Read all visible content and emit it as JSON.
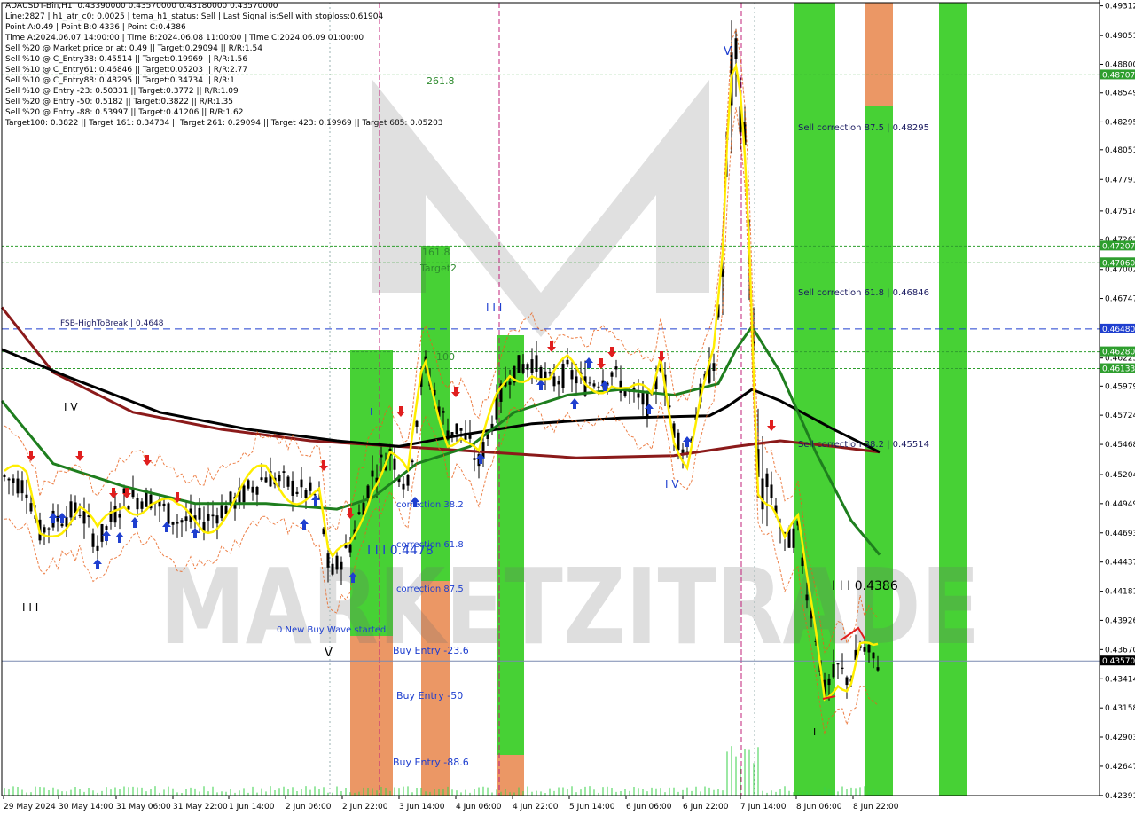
{
  "header": {
    "lines": [
      "ADAUSDT-Bin,H1  0.43390000 0.43570000 0.43180000 0.43570000",
      "Line:2827 | h1_atr_c0: 0.0025 | tema_h1_status: Sell | Last Signal is:Sell with stoploss:0.61904",
      "Point A:0.49 | Point B:0.4336 | Point C:0.4386",
      "Time A:2024.06.07 14:00:00 | Time B:2024.06.08 11:00:00 | Time C:2024.06.09 01:00:00",
      "Sell %20 @ Market price or at: 0.49 || Target:0.29094 || R/R:1.54",
      "Sell %10 @ C_Entry38: 0.45514 || Target:0.19969 || R/R:1.56",
      "Sell %10 @ C_Entry61: 0.46846 || Target:0.05203 || R/R:2.77",
      "Sell %10 @ C_Entry88: 0.48295 || Target:0.34734 || R/R:1",
      "Sell %10 @ Entry -23: 0.50331 || Target:0.3772 || R/R:1.09",
      "Sell %20 @ Entry -50: 0.5182 || Target:0.3822 || R/R:1.35",
      "Sell %20 @ Entry -88: 0.53997 || Target:0.41206 || R/R:1.62",
      "Target100: 0.3822 || Target 161: 0.34734 || Target 261: 0.29094 || Target 423: 0.19969 || Target 685: 0.05203"
    ]
  },
  "chart_data": {
    "type": "candlestick",
    "symbol": "ADAUSDT-Bin,H1",
    "ylim": [
      0.4239,
      0.4934
    ],
    "y_ticks": [
      "0.49312",
      "0.49051",
      "0.48800",
      "0.48549",
      "0.48295",
      "0.48051",
      "0.47791",
      "0.47514",
      "0.47263",
      "0.47002",
      "0.46747",
      "0.46480",
      "0.46225",
      "0.45979",
      "0.45724",
      "0.45468",
      "0.45204",
      "0.44949",
      "0.44693",
      "0.44437",
      "0.44181",
      "0.43926",
      "0.43670",
      "0.43414",
      "0.43158",
      "0.42903",
      "0.42647",
      "0.42391"
    ],
    "x_ticks": [
      "29 May 2024",
      "30 May 14:00",
      "31 May 06:00",
      "31 May 22:00",
      "1 Jun 14:00",
      "2 Jun 06:00",
      "2 Jun 22:00",
      "3 Jun 14:00",
      "4 Jun 06:00",
      "4 Jun 22:00",
      "5 Jun 14:00",
      "6 Jun 06:00",
      "6 Jun 22:00",
      "7 Jun 14:00",
      "8 Jun 06:00",
      "8 Jun 22:00"
    ],
    "price_tags": [
      {
        "value": "0.48707",
        "color": "#2e9e2e"
      },
      {
        "value": "0.47207",
        "color": "#2e9e2e"
      },
      {
        "value": "0.47060",
        "color": "#2e9e2e"
      },
      {
        "value": "0.46480",
        "color": "#1f3fcf"
      },
      {
        "value": "0.46280",
        "color": "#2e9e2e"
      },
      {
        "value": "0.46133",
        "color": "#2e9e2e"
      },
      {
        "value": "0.43570",
        "color": "#000000"
      }
    ],
    "levels": [
      {
        "value": 0.48707,
        "color": "#2e9e2e",
        "style": "dotted"
      },
      {
        "value": 0.47207,
        "color": "#2e9e2e",
        "style": "dotted"
      },
      {
        "value": 0.4706,
        "color": "#2e9e2e",
        "style": "dotted"
      },
      {
        "value": 0.4648,
        "color": "#1f3fcf",
        "style": "dashed"
      },
      {
        "value": 0.4628,
        "color": "#2e9e2e",
        "style": "dotted"
      },
      {
        "value": 0.46133,
        "color": "#2e9e2e",
        "style": "dotted"
      },
      {
        "value": 0.4357,
        "color": "#7a8ab0",
        "style": "solid"
      }
    ],
    "annotations": [
      {
        "text": "FSB-HighToBreak | 0.4648",
        "color": "#1a1a60"
      },
      {
        "text": "261.8",
        "color": "#2e8b2e"
      },
      {
        "text": "161.8",
        "color": "#2e8b2e"
      },
      {
        "text": "Target2",
        "color": "#2e8b2e"
      },
      {
        "text": "100",
        "color": "#2e8b2e"
      },
      {
        "text": "Sell correction 87.5 | 0.48295",
        "color": "#1a1a60"
      },
      {
        "text": "Sell correction 61.8 | 0.46846",
        "color": "#1a1a60"
      },
      {
        "text": "Sell correction 38.2 | 0.45514",
        "color": "#1a1a60"
      },
      {
        "text": "correction 38.2",
        "color": "#1f3fcf"
      },
      {
        "text": "correction 61.8",
        "color": "#1f3fcf"
      },
      {
        "text": "correction 87.5",
        "color": "#1f3fcf"
      },
      {
        "text": "0 New Buy Wave started",
        "color": "#1f3fcf"
      },
      {
        "text": "Buy Entry -23.6",
        "color": "#1f3fcf"
      },
      {
        "text": "Buy Entry -50",
        "color": "#1f3fcf"
      },
      {
        "text": "Buy Entry -88.6",
        "color": "#1f3fcf"
      },
      {
        "text": "I I I 0.4478",
        "color": "#1f3fcf"
      },
      {
        "text": "I I I 0.4386",
        "color": "#000000"
      },
      {
        "text": "I I I",
        "color": "#1f3fcf"
      },
      {
        "text": "I V",
        "color": "#000000"
      },
      {
        "text": "I I I",
        "color": "#000000"
      },
      {
        "text": "I V",
        "color": "#1f3fcf"
      },
      {
        "text": "V",
        "color": "#1f3fcf"
      },
      {
        "text": "V",
        "color": "#000000"
      },
      {
        "text": "I",
        "color": "#1f3fcf"
      },
      {
        "text": "I",
        "color": "#000000"
      }
    ],
    "watermark": "MARKETZITRADE",
    "colors": {
      "ma_slow": "#000000",
      "ma_200": "#8b1a1a",
      "ma_mid": "#1e7e1e",
      "tema": "#ffee00",
      "zone_green": "#33cc1f",
      "zone_orange": "#e8854a",
      "bull_arrow": "#1f3fcf",
      "bear_arrow": "#e01e1e"
    }
  }
}
